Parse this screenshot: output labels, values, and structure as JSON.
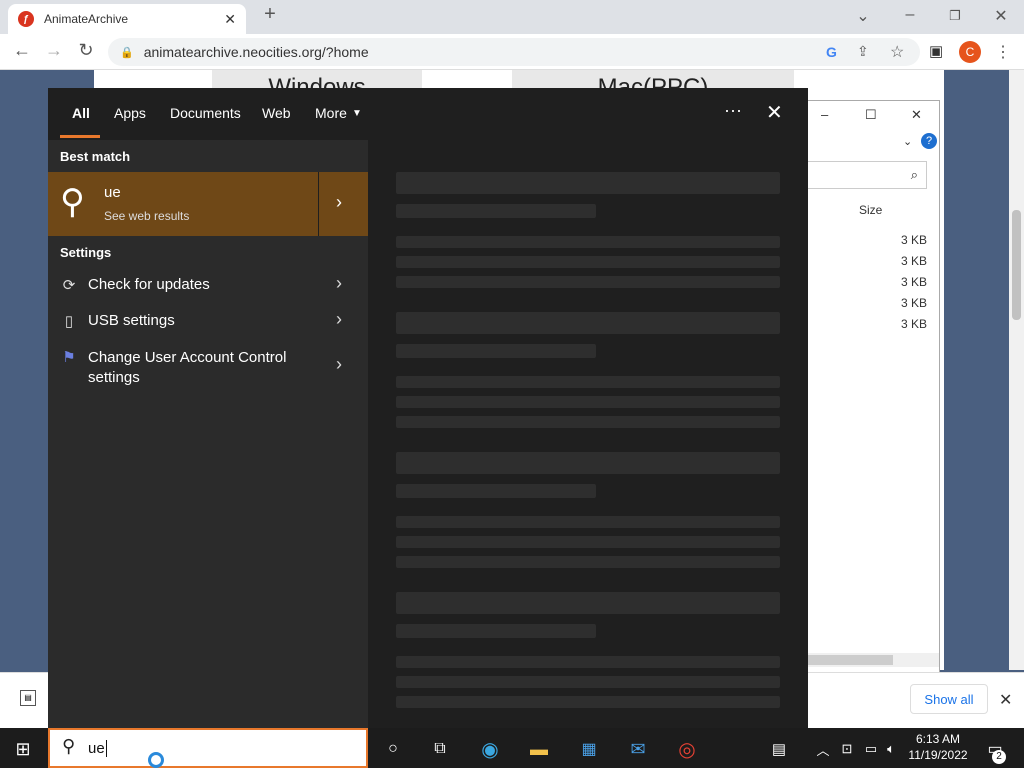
{
  "browser": {
    "tab_title": "AnimateArchive",
    "tab_favicon": "flash",
    "url": "animatearchive.neocities.org/?home",
    "profile_initial": "C"
  },
  "page": {
    "col1": "Windows",
    "col2": "Mac(PPC)"
  },
  "explorer": {
    "size_header": "Size",
    "sizes": [
      "3 KB",
      "3 KB",
      "3 KB",
      "3 KB",
      "3 KB"
    ]
  },
  "shelf": {
    "show_all": "Show all"
  },
  "search": {
    "filters": [
      "All",
      "Apps",
      "Documents",
      "Web",
      "More"
    ],
    "best_match_heading": "Best match",
    "best_match": {
      "title": "ue",
      "subtitle": "See web results"
    },
    "settings_heading": "Settings",
    "settings": [
      {
        "label": "Check for updates",
        "icon": "refresh-icon"
      },
      {
        "label": "USB settings",
        "icon": "usb-icon"
      },
      {
        "label": "Change User Account Control settings",
        "icon": "uac-flag-icon"
      }
    ],
    "query": "ue"
  },
  "taskbar": {
    "time": "6:13 AM",
    "date": "11/19/2022",
    "notification_count": "2"
  },
  "colors": {
    "accent": "#e8782c",
    "best_match_bg": "#6f4817",
    "panel_bg": "#1f1f1f"
  }
}
